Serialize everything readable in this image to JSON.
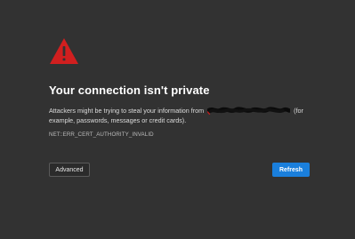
{
  "colors": {
    "background": "#323232",
    "warning_red": "#d11f1f",
    "accent_blue": "#1a7fdc"
  },
  "icon": {
    "name": "warning-icon"
  },
  "interstitial": {
    "title": "Your connection isn't private",
    "message_before": "Attackers might be trying to steal your information from",
    "message_after": "(for example, passwords, messages or credit cards).",
    "error_code": "NET::ERR_CERT_AUTHORITY_INVALID"
  },
  "buttons": {
    "advanced_label": "Advanced",
    "refresh_label": "Refresh"
  }
}
